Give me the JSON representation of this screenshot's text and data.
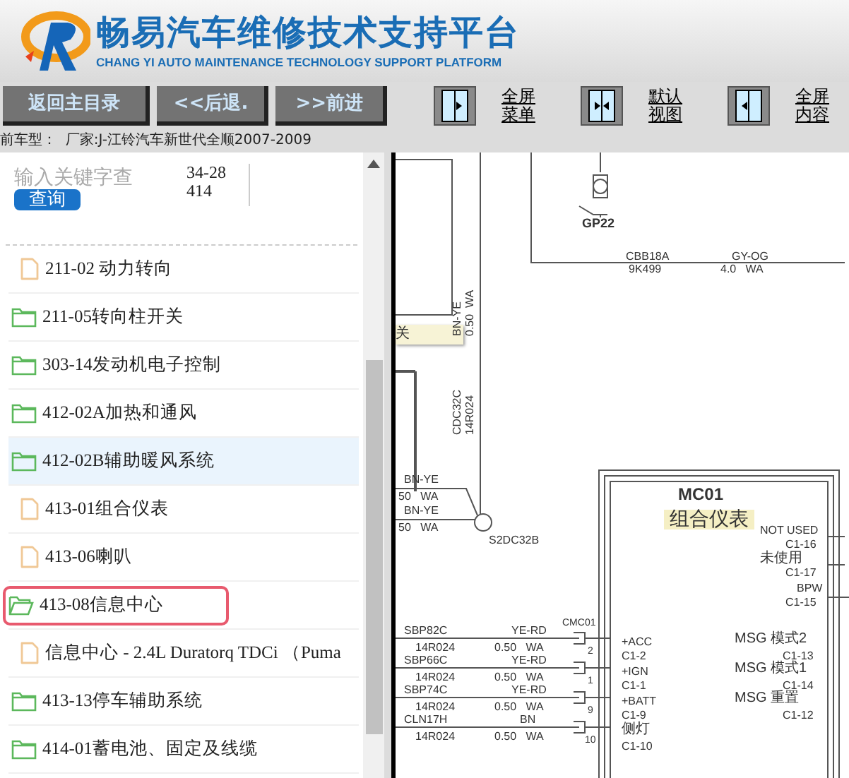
{
  "header": {
    "title": "畅易汽车维修技术支持平台",
    "subtitle": "CHANG YI AUTO MAINTENANCE TECHNOLOGY SUPPORT PLATFORM"
  },
  "nav_buttons": [
    "返回主目录",
    "<<后退.",
    ">>前进"
  ],
  "view_buttons": [
    {
      "kind": "right",
      "label": "全屏菜单"
    },
    {
      "kind": "both",
      "label": "默认视图"
    },
    {
      "kind": "left",
      "label": "全屏内容"
    }
  ],
  "vehicle_line": "前车型：  厂家:J-江铃汽车新世代全顺2007-2009",
  "search": {
    "placeholder": "输入关键字查",
    "code": "34-28414",
    "button": "查询"
  },
  "tree": [
    {
      "kind": "file",
      "label": "211-02 动力转向",
      "selected": false,
      "marked": false
    },
    {
      "kind": "folder",
      "label": "211-05转向柱开关",
      "selected": false,
      "marked": false,
      "expanded": false
    },
    {
      "kind": "folder",
      "label": "303-14发动机电子控制",
      "selected": false,
      "marked": false,
      "expanded": false
    },
    {
      "kind": "folder",
      "label": "412-02A加热和通风",
      "selected": false,
      "marked": false,
      "expanded": false
    },
    {
      "kind": "folder",
      "label": "412-02B辅助暖风系统",
      "selected": true,
      "marked": false,
      "expanded": false
    },
    {
      "kind": "file",
      "label": "413-01组合仪表",
      "selected": false,
      "marked": false
    },
    {
      "kind": "file",
      "label": "413-06喇叭",
      "selected": false,
      "marked": false
    },
    {
      "kind": "folder",
      "label": "413-08信息中心",
      "selected": false,
      "marked": true,
      "expanded": true
    },
    {
      "kind": "file",
      "label": "信息中心 - 2.4L Duratorq TDCi （Puma",
      "selected": false,
      "marked": false
    },
    {
      "kind": "folder",
      "label": "413-13停车辅助系统",
      "selected": false,
      "marked": false,
      "expanded": false
    },
    {
      "kind": "folder",
      "label": "414-01蓄电池、固定及线缆",
      "selected": false,
      "marked": false,
      "expanded": false
    }
  ],
  "diagram": {
    "tooltip": "关",
    "labels": [
      "GP22",
      "CBB18A",
      "9K499",
      "GY-OG",
      "4.0   WA",
      "BN-YE",
      "0.50  WA",
      "CDC32C",
      "14R024",
      "BN-YE",
      "50   WA",
      "BN-YE",
      "50   WA",
      "S2DC32B",
      "MC01",
      "组合仪表",
      "NOT USED",
      "C1-16",
      "未使用",
      "C1-17",
      "BPW",
      "C1-15",
      "SBP82C",
      "14R024",
      "YE-RD",
      "0.50   WA",
      "CMC01",
      "2",
      "+ACC",
      "C1-2",
      "SBP66C",
      "14R024",
      "YE-RD",
      "0.50   WA",
      "1",
      "+IGN",
      "C1-1",
      "SBP74C",
      "14R024",
      "YE-RD",
      "0.50   WA",
      "9",
      "+BATT",
      "C1-9",
      "CLN17H",
      "14R024",
      "BN",
      "0.50   WA",
      "10",
      "侧灯",
      "C1-10",
      "MSG 模式2",
      "C1-13",
      "MSG 模式1",
      "C1-14",
      "MSG 重置",
      "C1-12"
    ]
  }
}
